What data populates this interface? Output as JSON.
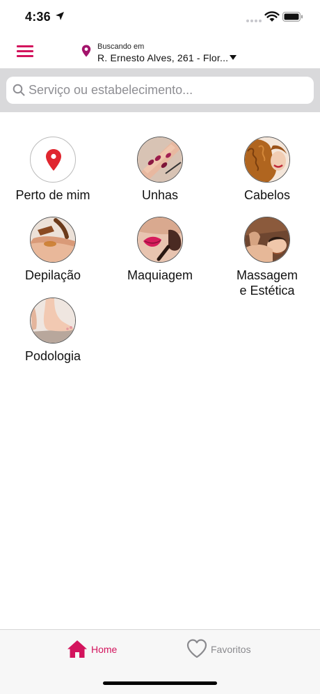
{
  "status_bar": {
    "time": "4:36"
  },
  "header": {
    "menu_icon": "hamburger-menu-icon",
    "location_prefix": "Buscando em",
    "location_address": "R. Ernesto Alves, 261 - Flor...",
    "accent_color": "#d3145d"
  },
  "search": {
    "placeholder": "Serviço ou estabelecimento..."
  },
  "categories": [
    {
      "label": "Perto de mim",
      "icon": "location-pin-icon"
    },
    {
      "label": "Unhas",
      "icon": "nails-image"
    },
    {
      "label": "Cabelos",
      "icon": "hair-image"
    },
    {
      "label": "Depilação",
      "icon": "waxing-image"
    },
    {
      "label": "Maquiagem",
      "icon": "makeup-image"
    },
    {
      "label": "Massagem\ne Estética",
      "icon": "massage-image"
    },
    {
      "label": "Podologia",
      "icon": "podiatry-image"
    }
  ],
  "tab_bar": {
    "home_label": "Home",
    "favorites_label": "Favoritos",
    "active_color": "#d3145d",
    "inactive_color": "#8a8a8e"
  }
}
